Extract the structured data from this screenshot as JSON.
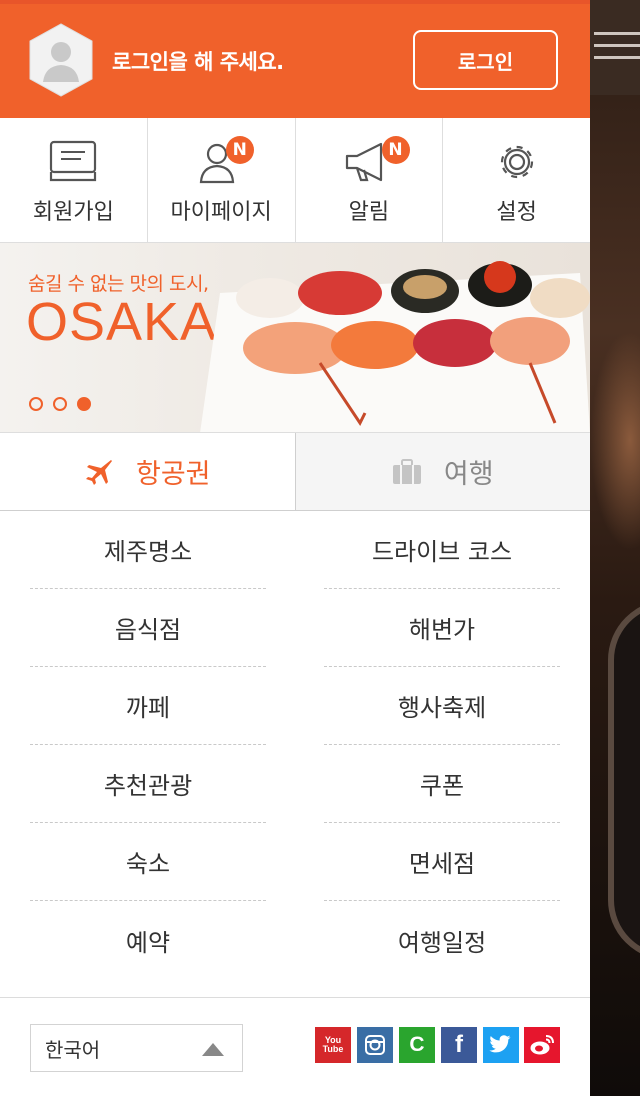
{
  "header": {
    "message": "로그인을 해 주세요.",
    "login_label": "로그인"
  },
  "quick_menu": [
    {
      "label": "회원가입",
      "icon": "signup-card-icon",
      "badge": ""
    },
    {
      "label": "마이페이지",
      "icon": "user-icon",
      "badge": "N"
    },
    {
      "label": "알림",
      "icon": "megaphone-icon",
      "badge": "N"
    },
    {
      "label": "설정",
      "icon": "gear-icon",
      "badge": ""
    }
  ],
  "banner": {
    "subtitle": "숨길 수 없는 맛의 도시,",
    "title": "OSAKA",
    "slides_total": 3,
    "active_slide": 3
  },
  "tabs": [
    {
      "label": "항공권",
      "icon": "airplane-icon",
      "active": true
    },
    {
      "label": "여행",
      "icon": "suitcase-icon",
      "active": false
    }
  ],
  "menu_grid": [
    [
      "제주명소",
      "드라이브 코스"
    ],
    [
      "음식점",
      "해변가"
    ],
    [
      "까페",
      "행사축제"
    ],
    [
      "추천관광",
      "쿠폰"
    ],
    [
      "숙소",
      "면세점"
    ],
    [
      "예약",
      "여행일정"
    ]
  ],
  "footer": {
    "language": "한국어",
    "social": [
      {
        "name": "youtube-icon",
        "text": "You Tube",
        "color": "#d5272a"
      },
      {
        "name": "instagram-icon",
        "text": "",
        "color": "#3a6ea5"
      },
      {
        "name": "c-icon",
        "text": "C",
        "color": "#2aa52e"
      },
      {
        "name": "facebook-icon",
        "text": "f",
        "color": "#3b5998"
      },
      {
        "name": "twitter-icon",
        "text": "",
        "color": "#1da1f2"
      },
      {
        "name": "weibo-icon",
        "text": "",
        "color": "#e6162d"
      }
    ]
  },
  "colors": {
    "accent": "#f0612b"
  }
}
